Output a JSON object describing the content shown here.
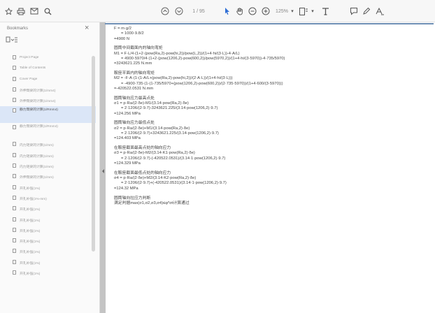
{
  "toolbar": {
    "left_icons": [
      "star-icon",
      "print-icon",
      "mail-icon",
      "search-icon"
    ],
    "page_indicator": "1 / 95",
    "zoom": "125%",
    "right_icons": [
      "upload-icon",
      "download-icon",
      "sign-icon",
      "pen-icon",
      "highlight-icon",
      "text-icon"
    ]
  },
  "sidebar": {
    "title": "Bookmarks",
    "close": "×",
    "items": [
      {
        "label": "Project Page"
      },
      {
        "label": "Table of Contents"
      },
      {
        "label": "Cover Page"
      },
      {
        "label": "外伸臂梁的计算(1/mm4)"
      },
      {
        "label": "外伸臂梁的计算(1/mm4)"
      },
      {
        "label": "静力臂梁的计算(1/Rmm4)",
        "selected": true
      },
      {
        "label": "静力臂梁的计算(1/Rmm4)"
      },
      {
        "label": "内力矩梁的计算(1/mm)"
      },
      {
        "label": "内力矩梁的计算(1/mm)"
      },
      {
        "label": "内力矩梁的计算(1/mm)"
      },
      {
        "label": "外伸臂梁的计算(1/mm)"
      },
      {
        "label": "开孔补强(1%)"
      },
      {
        "label": "开孔补强(1%-mm)"
      },
      {
        "label": "开孔补强(1%)"
      },
      {
        "label": "开孔补强(1%)"
      },
      {
        "label": "开孔补强(1%)"
      },
      {
        "label": "开孔补强(1%)"
      },
      {
        "label": "开孔补强(1%)"
      },
      {
        "label": "开孔补强(1%)"
      },
      {
        "label": "开孔补强(1%)"
      }
    ]
  },
  "document": {
    "blocks": [
      {
        "lines": [
          "F = m·g/2",
          "= 1000·9.8/2",
          "=4900 N"
        ]
      },
      {
        "lines": [
          "圆筒中间截面内的轴向弯矩",
          "M1 = F·L/4·(1+2·(pow(Ra,2)-pow(hi,2))/pow(L,2))/(1+4·hi/(3·L))-4·A/L)",
          "= 4900·5970/4·(1+2·(pow(1206,2)-pow(600,2))/pow(5970,2))/(1+4·hi/(3·5970))-4·735/5970)",
          "=3243621.225 N.mm"
        ]
      },
      {
        "lines": [
          "鞍座平面内的轴向弯矩",
          "M2 = -F·A·(1-(1-A/L+(pow(Ra,2)-pow(hi,2))/(2·A·L))/(1+4·hi/(3·L)))",
          "= -4900·735·(1-(1-735/5970+(pow(1206,2)-pow(600,2))/(2·735·5970))/(1+4·600/(3·5970)))",
          "=-420522.0531 N.mm"
        ]
      },
      {
        "lines": [
          "圆筒轴向应力最高点处",
          "σ1 = p·Ra/(2·δe)-M1/(3.14·pow(Ra,2)·δe)",
          "= 2·1206/(2·9.7)-3243621.225/(3.14·pow(1206,2)·9.7)",
          "=124.256 MPa"
        ]
      },
      {
        "lines": [
          "圆筒轴向应力最低点处",
          "σ2 = p·Ra/(2·δe)+M1/(3.14·pow(Ra,2)·δe)",
          "= 2·1206/(2·9.7)+3243621.225/(3.14·pow(1206,2)·9.7)",
          "=124.403 MPa"
        ]
      },
      {
        "lines": [
          "在鞍座截面最高点处的轴向应力",
          "σ3 = p·Ra/(2·δe)-M2/(3.14·K1·pow(Ra,2)·δe)",
          "= 2·1206/(2·9.7)-(-420522.0531)/(3.14·1·pow(1206,2)·9.7)",
          "=124.329 MPa"
        ]
      },
      {
        "lines": [
          "在鞍座截面最低点处的轴向应力",
          "σ4 = p·Ra/(2·δe)+M2/(3.14·K2·pow(Ra,2)·δe)",
          "= 2·1206/(2·9.7)+(-420522.0531)/(3.14·1·pow(1206,2)·9.7)",
          "=124.32 MPa"
        ]
      },
      {
        "lines": [
          "圆筒轴向拉应力判断",
          "满足判据max(σ1,σ2,σ3,σ4)≤φ*σt计算通过"
        ]
      }
    ]
  }
}
